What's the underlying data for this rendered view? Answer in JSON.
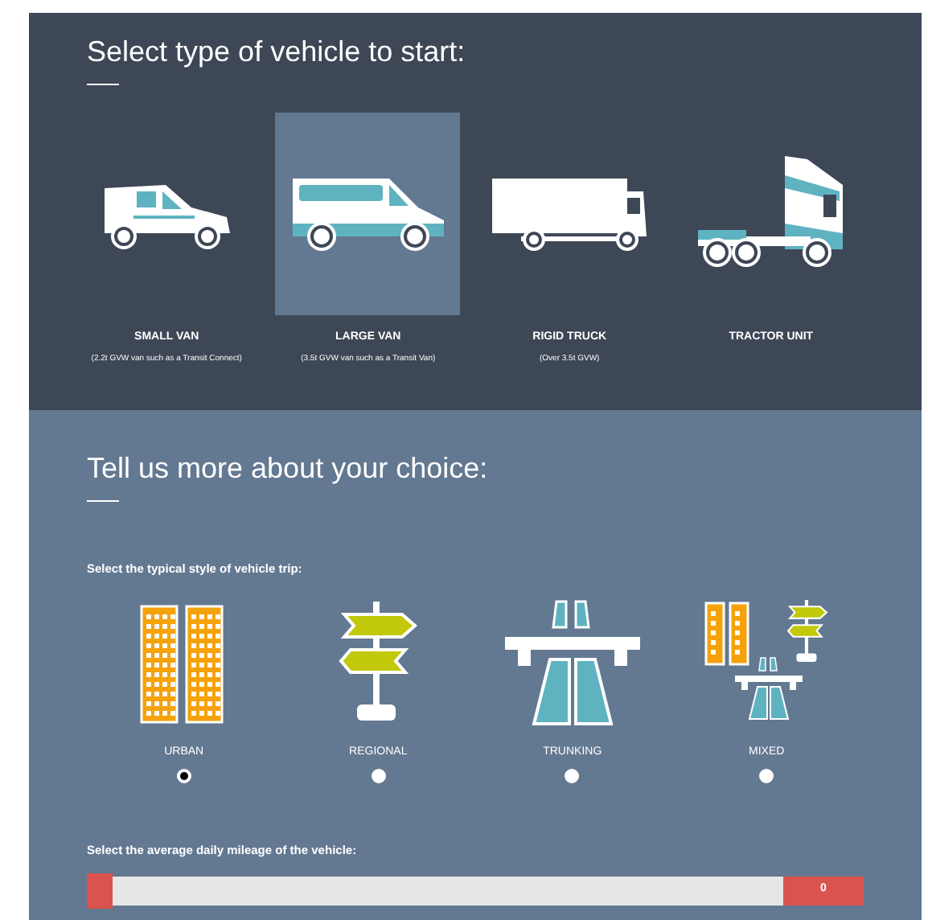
{
  "vehicle_section": {
    "title": "Select type of vehicle to start:",
    "vehicles": [
      {
        "kind": "small_van",
        "label": "SMALL VAN",
        "note": "(2.2t GVW van such as a Transit Connect)",
        "selected": false
      },
      {
        "kind": "large_van",
        "label": "LARGE VAN",
        "note": "(3.5t GVW van such as a Transit Van)",
        "selected": true
      },
      {
        "kind": "rigid_truck",
        "label": "RIGID TRUCK",
        "note": "(Over 3.5t GVW)",
        "selected": false
      },
      {
        "kind": "tractor",
        "label": "TRACTOR UNIT",
        "selected": false
      }
    ]
  },
  "choice_section": {
    "title": "Tell us more about your choice:",
    "trip_prompt": "Select the typical style of vehicle trip:",
    "trips": [
      {
        "kind": "urban",
        "label": "URBAN",
        "selected": true
      },
      {
        "kind": "regional",
        "label": "REGIONAL",
        "selected": false
      },
      {
        "kind": "trunking",
        "label": "TRUNKING",
        "selected": false
      },
      {
        "kind": "mixed",
        "label": "MIXED",
        "selected": false
      }
    ],
    "mileage_prompt": "Select the average daily mileage of the vehicle:",
    "mileage": {
      "level": 0,
      "reading": "0"
    }
  }
}
